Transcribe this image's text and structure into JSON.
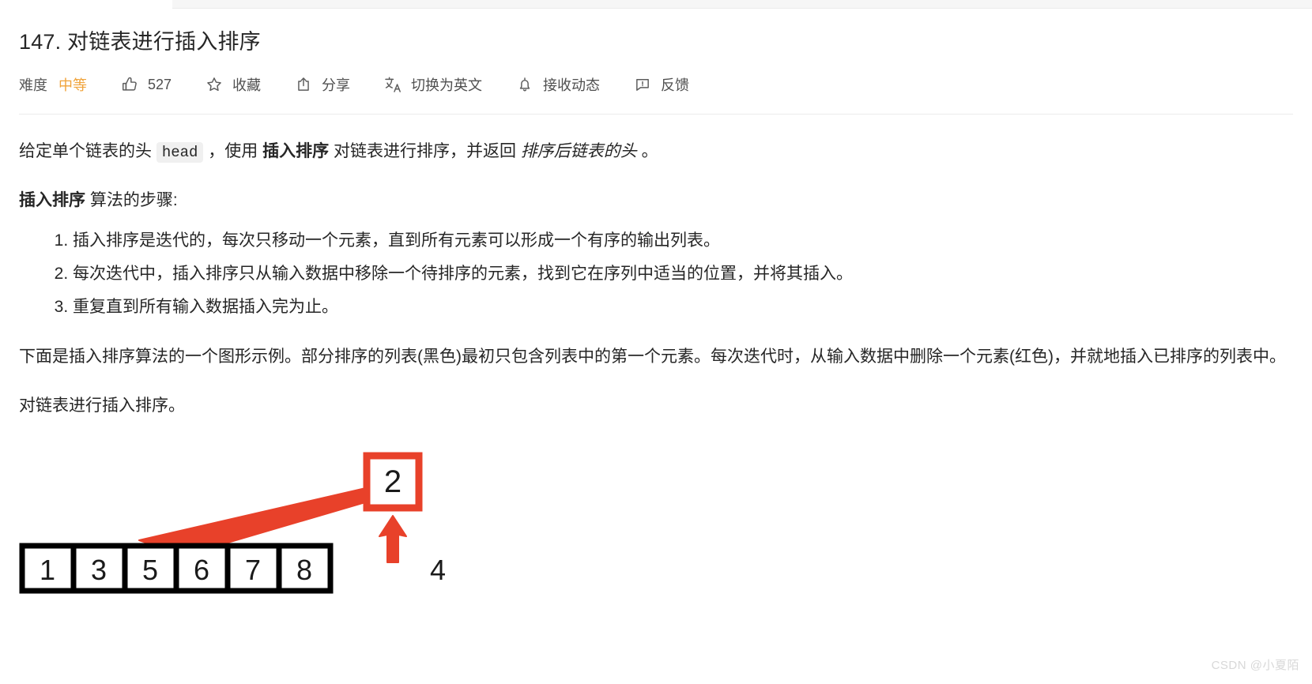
{
  "window": {
    "tabstrip_visible": true
  },
  "header": {
    "title": "147. 对链表进行插入排序"
  },
  "toolbar": {
    "difficulty_label": "难度",
    "difficulty_value": "中等",
    "difficulty_color": "#f0a33a",
    "like_count": "527",
    "like_icon": "thumbs-up-icon",
    "favorite_label": "收藏",
    "favorite_icon": "star-icon",
    "share_label": "分享",
    "share_icon": "share-icon",
    "translate_label": "切换为英文",
    "translate_icon": "translate-icon",
    "subscribe_label": "接收动态",
    "subscribe_icon": "bell-icon",
    "feedback_label": "反馈",
    "feedback_icon": "feedback-icon"
  },
  "content": {
    "intro": {
      "part1": "给定单个链表的头 ",
      "code": "head",
      "part2": " ，使用 ",
      "bold1": "插入排序",
      "part3": " 对链表进行排序，并返回 ",
      "italic1": "排序后链表的头",
      "part4": " 。"
    },
    "steps_heading": {
      "bold": "插入排序",
      "rest": " 算法的步骤:"
    },
    "steps": [
      "插入排序是迭代的，每次只移动一个元素，直到所有元素可以形成一个有序的输出列表。",
      "每次迭代中，插入排序只从输入数据中移除一个待排序的元素，找到它在序列中适当的位置，并将其插入。",
      "重复直到所有输入数据插入完为止。"
    ],
    "description": "下面是插入排序算法的一个图形示例。部分排序的列表(黑色)最初只包含列表中的第一个元素。每次迭代时，从输入数据中删除一个元素(红色)，并就地插入已排序的列表中。",
    "closing": "对链表进行插入排序。"
  },
  "diagram": {
    "name": "insertion-sort-illustration",
    "sorted_cells": [
      "1",
      "3",
      "5",
      "6",
      "7",
      "8"
    ],
    "highlighted_value": "2",
    "remaining_value": "4",
    "highlight_color": "#e8412a",
    "cell_border_color": "#000000",
    "arrow_color": "#e8412a"
  },
  "watermark": {
    "text": "CSDN @小夏陌"
  }
}
